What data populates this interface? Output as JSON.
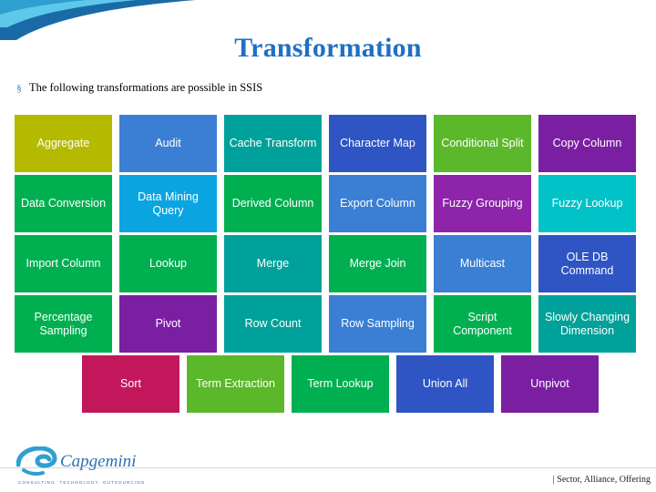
{
  "slide": {
    "title": "Transformation",
    "bullet_marker": "§",
    "bullet_text": "The following transformations are possible in SSIS"
  },
  "footer": {
    "right_text": "| Sector, Alliance, Offering",
    "logo_text": "Capgemini",
    "logo_tagline": "CONSULTING. TECHNOLOGY. OUTSOURCING"
  },
  "grid": {
    "rows": [
      [
        {
          "label": "Aggregate",
          "color": "#b5ba00"
        },
        {
          "label": "Audit",
          "color": "#3b7fd4"
        },
        {
          "label": "Cache Transform",
          "color": "#00a19a"
        },
        {
          "label": "Character Map",
          "color": "#2f55c4"
        },
        {
          "label": "Conditional Split",
          "color": "#5bb82a"
        },
        {
          "label": "Copy Column",
          "color": "#7b1fa2"
        }
      ],
      [
        {
          "label": "Data Conversion",
          "color": "#00b050"
        },
        {
          "label": "Data Mining Query",
          "color": "#0aa5e0"
        },
        {
          "label": "Derived Column",
          "color": "#00b050"
        },
        {
          "label": "Export Column",
          "color": "#3b7fd4"
        },
        {
          "label": "Fuzzy Grouping",
          "color": "#8e24aa"
        },
        {
          "label": "Fuzzy Lookup",
          "color": "#00c2c7"
        }
      ],
      [
        {
          "label": "Import Column",
          "color": "#00b050"
        },
        {
          "label": "Lookup",
          "color": "#00b050"
        },
        {
          "label": "Merge",
          "color": "#00a19a"
        },
        {
          "label": "Merge Join",
          "color": "#00b050"
        },
        {
          "label": "Multicast",
          "color": "#3b7fd4"
        },
        {
          "label": "OLE DB Command",
          "color": "#2f55c4"
        }
      ],
      [
        {
          "label": "Percentage Sampling",
          "color": "#00b050"
        },
        {
          "label": "Pivot",
          "color": "#7b1fa2"
        },
        {
          "label": "Row Count",
          "color": "#00a19a"
        },
        {
          "label": "Row Sampling",
          "color": "#3b7fd4"
        },
        {
          "label": "Script Component",
          "color": "#00b050"
        },
        {
          "label": "Slowly Changing Dimension",
          "color": "#00a19a"
        }
      ],
      [
        {
          "label": "Sort",
          "color": "#c2185b"
        },
        {
          "label": "Term Extraction",
          "color": "#5bb82a"
        },
        {
          "label": "Term Lookup",
          "color": "#00b050"
        },
        {
          "label": "Union All",
          "color": "#2f55c4"
        },
        {
          "label": "Unpivot",
          "color": "#7b1fa2"
        }
      ]
    ]
  },
  "colors": {
    "title": "#1f6fc4",
    "swoosh_dark": "#1b6aa8",
    "swoosh_light": "#57c6e6"
  }
}
